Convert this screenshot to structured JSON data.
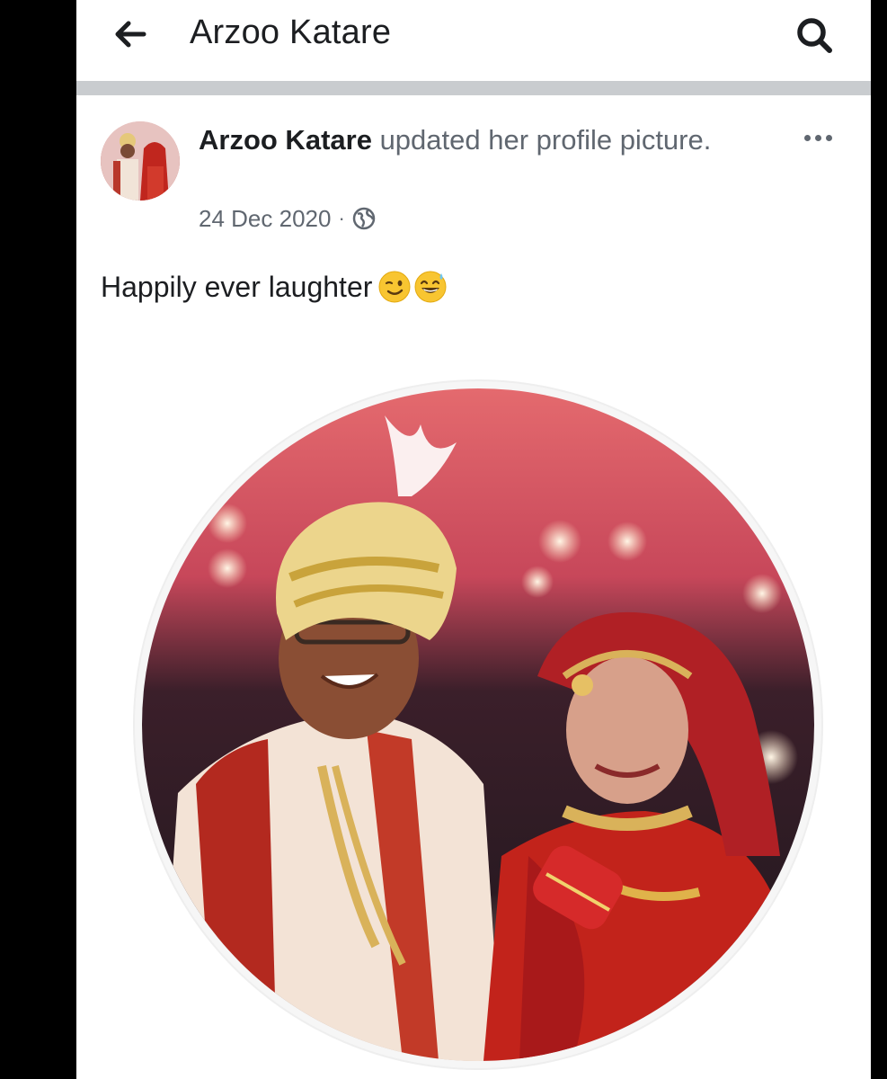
{
  "topbar": {
    "back_icon": "arrow-left-icon",
    "title": "Arzoo Katare",
    "search_icon": "search-icon"
  },
  "post": {
    "author": "Arzoo Katare",
    "action": "updated her profile picture.",
    "date": "24 Dec 2020",
    "separator": "·",
    "privacy_icon": "globe-icon",
    "more_icon": "more-horizontal-icon",
    "caption": "Happily ever laughter",
    "caption_emojis": [
      "winking-face-emoji",
      "grinning-face-with-sweat-emoji"
    ]
  },
  "colors": {
    "text_primary": "#1c1e21",
    "text_secondary": "#606770",
    "divider": "#c9cccf",
    "background": "#ffffff"
  }
}
